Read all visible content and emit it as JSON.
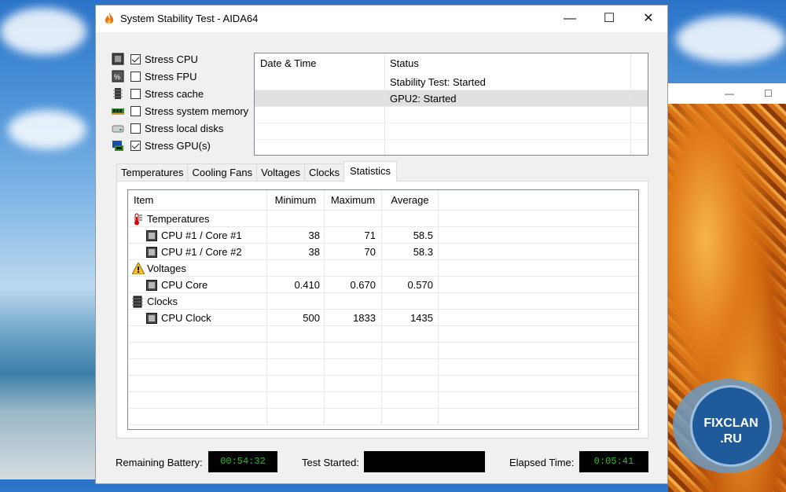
{
  "window": {
    "title": "System Stability Test - AIDA64",
    "controls": {
      "minimize": "—",
      "maximize": "☐",
      "close": "✕"
    }
  },
  "stress_options": [
    {
      "label": "Stress CPU",
      "checked": true,
      "icon": "cpu-icon"
    },
    {
      "label": "Stress FPU",
      "checked": false,
      "icon": "fpu-icon"
    },
    {
      "label": "Stress cache",
      "checked": false,
      "icon": "cache-icon"
    },
    {
      "label": "Stress system memory",
      "checked": false,
      "icon": "memory-icon"
    },
    {
      "label": "Stress local disks",
      "checked": false,
      "icon": "disk-icon"
    },
    {
      "label": "Stress GPU(s)",
      "checked": true,
      "icon": "gpu-icon"
    }
  ],
  "status_log": {
    "headers": [
      "Date & Time",
      "Status"
    ],
    "rows": [
      {
        "datetime": "",
        "status": "Stability Test: Started"
      },
      {
        "datetime": "",
        "status": "GPU2: Started"
      }
    ]
  },
  "tabs": [
    "Temperatures",
    "Cooling Fans",
    "Voltages",
    "Clocks",
    "Statistics"
  ],
  "active_tab": "Statistics",
  "statistics": {
    "headers": {
      "item": "Item",
      "min": "Minimum",
      "max": "Maximum",
      "avg": "Average"
    },
    "groups": [
      {
        "name": "Temperatures",
        "icon": "thermometer-icon",
        "rows": [
          {
            "item": "CPU #1 / Core #1",
            "min": "38",
            "max": "71",
            "avg": "58.5"
          },
          {
            "item": "CPU #1 / Core #2",
            "min": "38",
            "max": "70",
            "avg": "58.3"
          }
        ]
      },
      {
        "name": "Voltages",
        "icon": "warning-icon",
        "rows": [
          {
            "item": "CPU Core",
            "min": "0.410",
            "max": "0.670",
            "avg": "0.570"
          }
        ]
      },
      {
        "name": "Clocks",
        "icon": "clock-chip-icon",
        "rows": [
          {
            "item": "CPU Clock",
            "min": "500",
            "max": "1833",
            "avg": "1435"
          }
        ]
      }
    ]
  },
  "footer": {
    "battery_label": "Remaining Battery:",
    "battery_value": "00:54:32",
    "started_label": "Test Started:",
    "started_value": "",
    "elapsed_label": "Elapsed Time:",
    "elapsed_value": "0:05:41"
  },
  "watermark": {
    "line1": "FIXCLAN",
    "line2": ".RU"
  },
  "colors": {
    "timer_text": "#1ec81e",
    "selected_row": "#e0e0e0"
  }
}
